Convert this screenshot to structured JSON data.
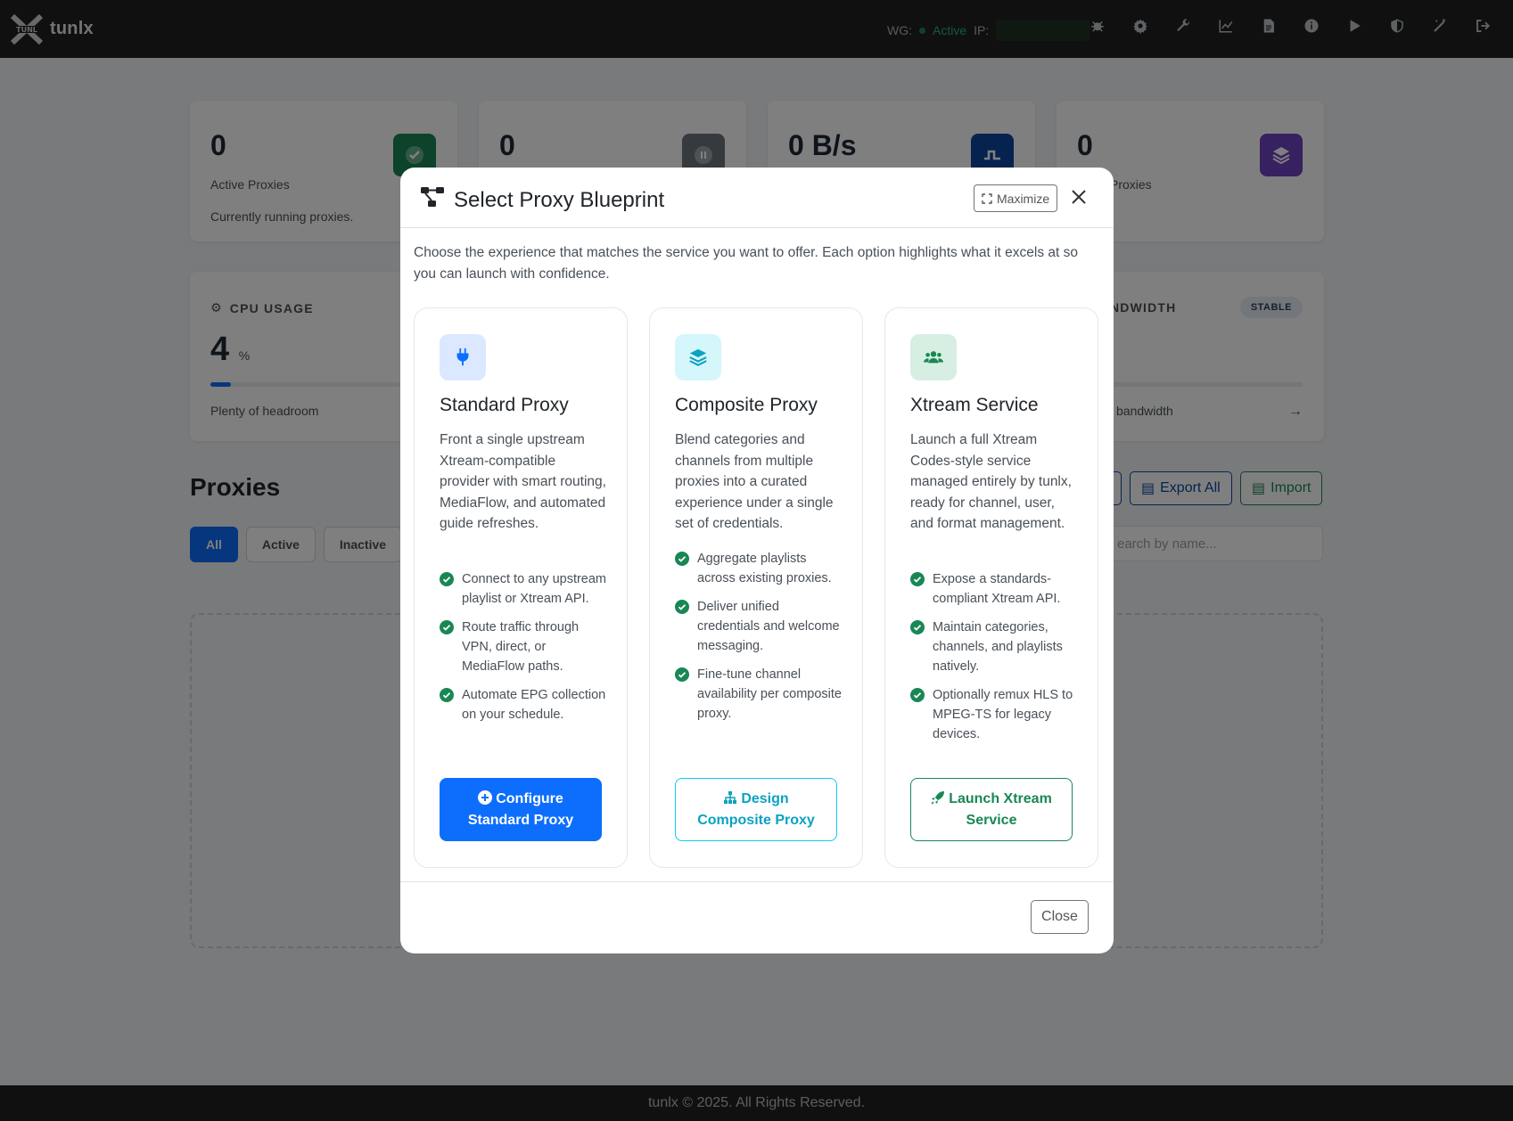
{
  "app": {
    "name": "tunlx",
    "logo_text": "TUNL X"
  },
  "navbar": {
    "wg_label": "WG:",
    "wg_status": "Active",
    "ip_label": "IP:",
    "icons": [
      "bug-icon",
      "gear-icon",
      "wrench-icon",
      "chart-line-icon",
      "file-icon",
      "info-icon",
      "play-icon",
      "shield-icon",
      "magic-wand-icon",
      "logout-icon"
    ]
  },
  "stats": [
    {
      "value": "0",
      "label": "Active Proxies",
      "sub": "Currently running proxies.",
      "color": "#198754"
    },
    {
      "value": "0",
      "label": "",
      "sub": "",
      "color": "#6c757d"
    },
    {
      "value": "0 B/s",
      "label": "",
      "sub": "",
      "color": "#0d47a1"
    },
    {
      "value": "0",
      "label": "Proxies",
      "sub": "",
      "color": "#6f42c1"
    }
  ],
  "cpu": {
    "title": "CPU USAGE",
    "value": "4",
    "unit": "%",
    "level_percent": 4,
    "sub": "Plenty of headroom"
  },
  "bandwidth": {
    "title": "NDWIDTH",
    "badge": "STABLE",
    "sub": "bandwidth"
  },
  "proxies": {
    "title": "Proxies",
    "filters": [
      "All",
      "Active",
      "Inactive"
    ],
    "export_label": "Export All",
    "import_label": "Import",
    "search_placeholder": "earch by name..."
  },
  "footer": {
    "text": "tunlx © 2025. All Rights Reserved."
  },
  "modal": {
    "title": "Select Proxy Blueprint",
    "maximize_label": "Maximize",
    "intro": "Choose the experience that matches the service you want to offer. Each option highlights what it excels at so you can launch with confidence.",
    "close_label": "Close",
    "options": [
      {
        "title": "Standard Proxy",
        "description": "Front a single upstream Xtream-compatible provider with smart routing, MediaFlow, and automated guide refreshes.",
        "features": [
          "Connect to any upstream playlist or Xtream API.",
          "Route traffic through VPN, direct, or MediaFlow paths.",
          "Automate EPG collection on your schedule."
        ],
        "button_label": "Configure Standard Proxy",
        "accent": "#0d6efd",
        "icon": "plug-icon"
      },
      {
        "title": "Composite Proxy",
        "description": "Blend categories and channels from multiple proxies into a curated experience under a single set of credentials.",
        "features": [
          "Aggregate playlists across existing proxies.",
          "Deliver unified credentials and welcome messaging.",
          "Fine-tune channel availability per composite proxy."
        ],
        "button_label": "Design Composite Proxy",
        "accent": "#0dcaf0",
        "icon": "layers-icon"
      },
      {
        "title": "Xtream Service",
        "description": "Launch a full Xtream Codes-style service managed entirely by tunlx, ready for channel, user, and format management.",
        "features": [
          "Expose a standards-compliant Xtream API.",
          "Maintain categories, channels, and playlists natively.",
          "Optionally remux HLS to MPEG-TS for legacy devices."
        ],
        "button_label": "Launch Xtream Service",
        "accent": "#198754",
        "icon": "users-icon"
      }
    ]
  }
}
